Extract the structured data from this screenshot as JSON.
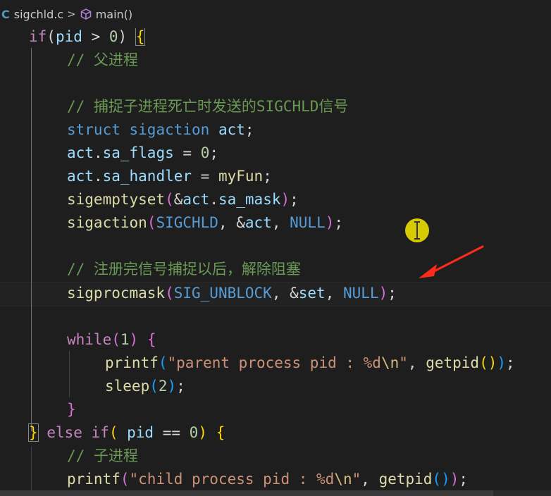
{
  "breadcrumb": {
    "file_icon": "C",
    "file": "sigchld.c",
    "separator": ">",
    "symbol_icon": "cube-icon",
    "symbol": "main()"
  },
  "code": {
    "l1": {
      "t1": "if",
      "t2": "(",
      "t3": "pid",
      "t4": " > ",
      "t5": "0",
      "t6": ") ",
      "t7": "{"
    },
    "l2": {
      "t1": "// 父进程"
    },
    "l4": {
      "t1": "// 捕捉子进程死亡时发送的SIGCHLD信号"
    },
    "l5": {
      "t1": "struct",
      "t2": " ",
      "t3": "sigaction",
      "t4": " ",
      "t5": "act",
      "t6": ";"
    },
    "l6": {
      "t1": "act",
      "t2": ".",
      "t3": "sa_flags",
      "t4": " = ",
      "t5": "0",
      "t6": ";"
    },
    "l7": {
      "t1": "act",
      "t2": ".",
      "t3": "sa_handler",
      "t4": " = ",
      "t5": "myFun",
      "t6": ";"
    },
    "l8": {
      "t1": "sigemptyset",
      "t2": "(",
      "t3": "&",
      "t4": "act",
      "t5": ".",
      "t6": "sa_mask",
      "t7": ")",
      "t8": ";"
    },
    "l9": {
      "t1": "sigaction",
      "t2": "(",
      "t3": "SIGCHLD",
      "t4": ", &",
      "t5": "act",
      "t6": ", ",
      "t7": "NULL",
      "t8": ")",
      "t9": ";"
    },
    "l11": {
      "t1": "// 注册完信号捕捉以后，解除阻塞"
    },
    "l12": {
      "t1": "sigprocmask",
      "t2": "(",
      "t3": "SIG_UNBLOCK",
      "t4": ", &",
      "t5": "set",
      "t6": ", ",
      "t7": "NULL",
      "t8": ")",
      "t9": ";"
    },
    "l14": {
      "t1": "while",
      "t2": "(",
      "t3": "1",
      "t4": ") ",
      "t5": "{"
    },
    "l15": {
      "t1": "printf",
      "t2": "(",
      "t3": "\"parent process pid : %d",
      "t4": "\\n",
      "t5": "\"",
      "t6": ", ",
      "t7": "getpid",
      "t8": "()",
      "t9": ")",
      "t10": ";"
    },
    "l16": {
      "t1": "sleep",
      "t2": "(",
      "t3": "2",
      "t4": ")",
      "t5": ";"
    },
    "l17": {
      "t1": "}"
    },
    "l18": {
      "t1": "}",
      "t2": " ",
      "t3": "else",
      "t4": " ",
      "t5": "if",
      "t6": "( ",
      "t7": "pid",
      "t8": " == ",
      "t9": "0",
      "t10": ") ",
      "t11": "{"
    },
    "l19": {
      "t1": "// 子进程"
    },
    "l20": {
      "t1": "printf",
      "t2": "(",
      "t3": "\"child process pid : %d",
      "t4": "\\n",
      "t5": "\"",
      "t6": ", ",
      "t7": "getpid",
      "t8": "()",
      "t9": ")",
      "t10": ";"
    }
  },
  "colors": {
    "background": "#1e1e1e",
    "keyword": "#c586c0",
    "type": "#569cd6",
    "function": "#dcdcaa",
    "variable": "#9cdcfe",
    "number": "#b5cea8",
    "string": "#ce9178",
    "comment": "#6a9955",
    "constant": "#4fc1ff",
    "annotation_arrow": "#ff2a1a",
    "cursor_highlight": "#e6d900"
  }
}
